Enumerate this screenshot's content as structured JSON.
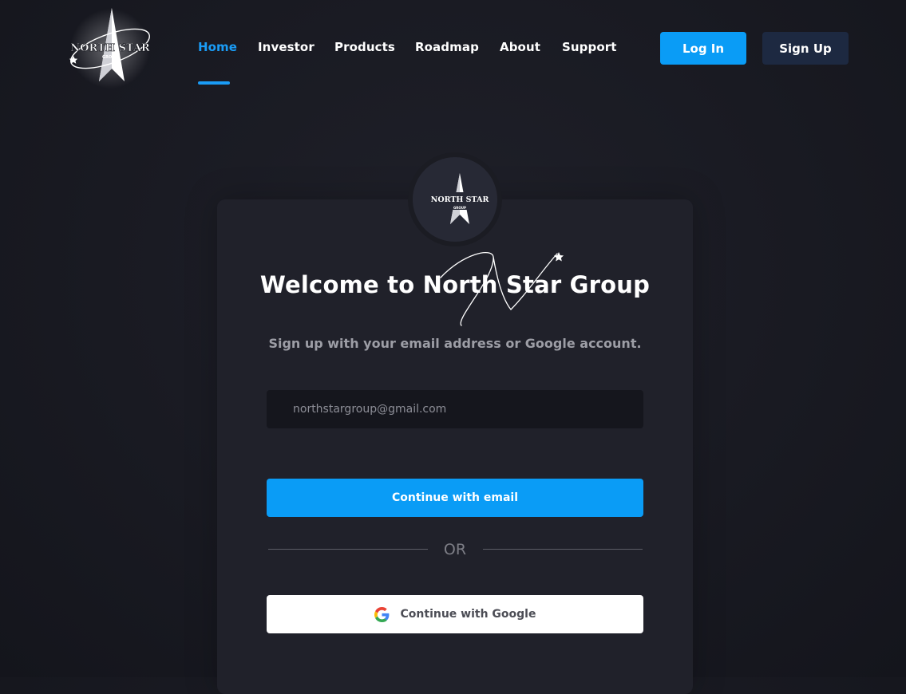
{
  "brand": {
    "logo_text": "NORTH STAR",
    "logo_subtext": "GROUP"
  },
  "nav": {
    "items": [
      {
        "label": "Home",
        "active": true
      },
      {
        "label": "Investor",
        "active": false
      },
      {
        "label": "Products",
        "active": false
      },
      {
        "label": "Roadmap",
        "active": false
      },
      {
        "label": "About",
        "active": false
      },
      {
        "label": "Support",
        "active": false
      }
    ],
    "login_label": "Log In",
    "signup_label": "Sign Up"
  },
  "signup_card": {
    "title": "Welcome to North Star Group",
    "subtitle": "Sign up with your email address or Google account.",
    "email_placeholder": "northstargroup@gmail.com",
    "continue_email_label": "Continue with email",
    "divider_text": "OR",
    "continue_google_label": "Continue with Google"
  },
  "colors": {
    "accent": "#0a9cf6",
    "background": "#191a22",
    "card": "#20212a",
    "signup_button": "#1d2941"
  },
  "icons": [
    "north-star-logo",
    "google-icon",
    "star-swoosh"
  ]
}
